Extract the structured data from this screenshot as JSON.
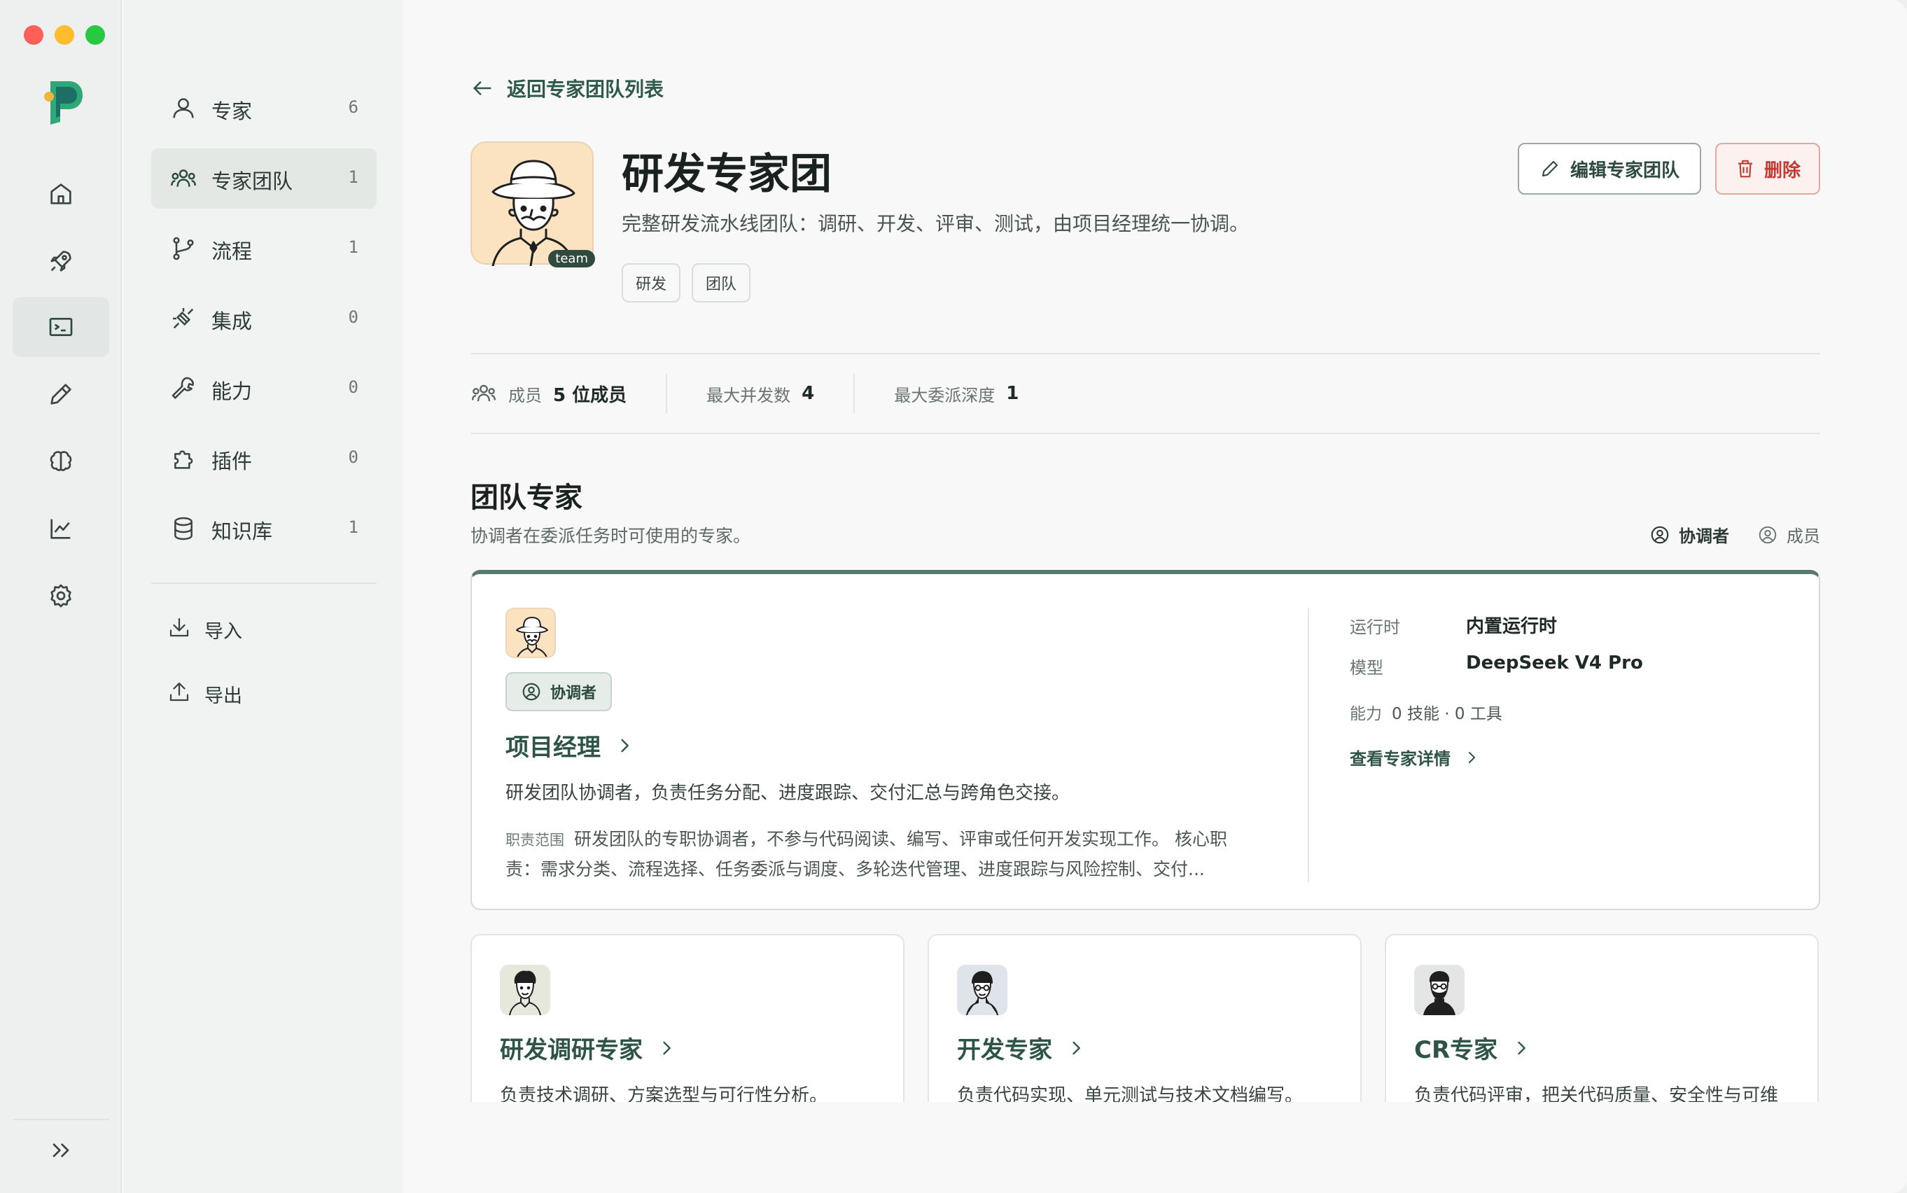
{
  "rail": {
    "items": [
      {
        "name": "home",
        "active": false
      },
      {
        "name": "rocket",
        "active": false
      },
      {
        "name": "terminal",
        "active": true
      },
      {
        "name": "pen",
        "active": false
      },
      {
        "name": "brain",
        "active": false
      },
      {
        "name": "chart",
        "active": false
      },
      {
        "name": "settings",
        "active": false
      }
    ]
  },
  "subnav": {
    "items": [
      {
        "label": "专家",
        "count": "6",
        "icon": "user-icon"
      },
      {
        "label": "专家团队",
        "count": "1",
        "icon": "users-icon",
        "active": true
      },
      {
        "label": "流程",
        "count": "1",
        "icon": "git-branch-icon"
      },
      {
        "label": "集成",
        "count": "0",
        "icon": "plug-icon"
      },
      {
        "label": "能力",
        "count": "0",
        "icon": "wrench-icon"
      },
      {
        "label": "插件",
        "count": "0",
        "icon": "puzzle-icon"
      },
      {
        "label": "知识库",
        "count": "1",
        "icon": "database-icon"
      }
    ],
    "actions": [
      {
        "label": "导入",
        "icon": "download-icon"
      },
      {
        "label": "导出",
        "icon": "upload-icon"
      }
    ]
  },
  "main": {
    "back_label": "返回专家团队列表",
    "team": {
      "badge": "team",
      "title": "研发专家团",
      "description": "完整研发流水线团队：调研、开发、评审、测试，由项目经理统一协调。",
      "tags": [
        "研发",
        "团队"
      ]
    },
    "buttons": {
      "edit": "编辑专家团队",
      "delete": "删除"
    },
    "stats": {
      "members_label": "成员",
      "members_value": "5 位成员",
      "concurrency_label": "最大并发数",
      "concurrency_value": "4",
      "depth_label": "最大委派深度",
      "depth_value": "1"
    },
    "section": {
      "title": "团队专家",
      "subtitle": "协调者在委派任务时可使用的专家。",
      "legend_coordinator": "协调者",
      "legend_member": "成员"
    },
    "coordinator": {
      "role": "协调者",
      "name": "项目经理",
      "description": "研发团队协调者，负责任务分配、进度跟踪、交付汇总与跨角色交接。",
      "scope_label": "职责范围",
      "scope": "研发团队的专职协调者，不参与代码阅读、编写、评审或任何开发实现工作。 核心职责：需求分类、流程选择、任务委派与调度、多轮迭代管理、进度跟踪与风险控制、交付...",
      "runtime_label": "运行时",
      "runtime_value": "内置运行时",
      "model_label": "模型",
      "model_value": "DeepSeek V4 Pro",
      "capability_label": "能力",
      "capability_value": "0 技能 · 0 工具",
      "detail_link": "查看专家详情"
    },
    "members": [
      {
        "name": "研发调研专家",
        "description": "负责技术调研、方案选型与可行性分析。"
      },
      {
        "name": "开发专家",
        "description": "负责代码实现、单元测试与技术文档编写。"
      },
      {
        "name": "CR专家",
        "description": "负责代码评审，把关代码质量、安全性与可维"
      }
    ]
  },
  "colors": {
    "accent": "#2d5446",
    "danger": "#c33a31",
    "avatar_bg": "#fbe3c2"
  }
}
